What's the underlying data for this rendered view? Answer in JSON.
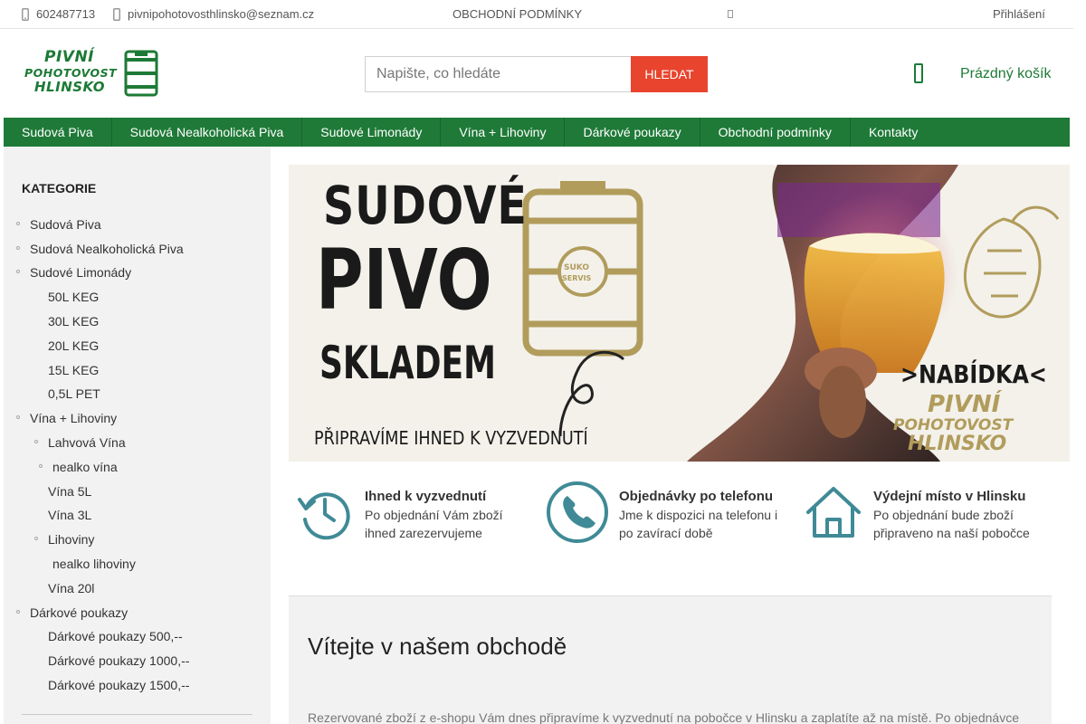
{
  "topbar": {
    "phone": "602487713",
    "email": "pivnipohotovosthlinsko@seznam.cz",
    "terms": "Obchodní podmínky",
    "login": "Přihlášení"
  },
  "logo": {
    "line1": "PIVNÍ",
    "line2": "POHOTOVOST",
    "line3": "HLINSKO"
  },
  "search": {
    "placeholder": "Napište, co hledáte",
    "button": "Hledat"
  },
  "cart": {
    "label": "Prázdný košík"
  },
  "nav": {
    "items": [
      {
        "label": "Sudová Piva"
      },
      {
        "label": "Sudová Nealkoholická Piva"
      },
      {
        "label": "Sudové Limonády"
      },
      {
        "label": "Vína + Lihoviny"
      },
      {
        "label": "Dárkové poukazy"
      },
      {
        "label": "Obchodní podmínky"
      },
      {
        "label": "Kontakty"
      }
    ]
  },
  "sidebar": {
    "title": "Kategorie",
    "categories": [
      {
        "label": "Sudová Piva"
      },
      {
        "label": "Sudová Nealkoholická Piva"
      },
      {
        "label": "Sudové Limonády"
      },
      {
        "label": "50L KEG"
      },
      {
        "label": "30L KEG"
      },
      {
        "label": "20L KEG"
      },
      {
        "label": "15L KEG"
      },
      {
        "label": "0,5L PET"
      },
      {
        "label": "Vína + Lihoviny"
      },
      {
        "label": "Lahvová Vína"
      },
      {
        "label": "nealko vína"
      },
      {
        "label": "Vína 5L"
      },
      {
        "label": "Vína 3L"
      },
      {
        "label": "Lihoviny"
      },
      {
        "label": "nealko lihoviny"
      },
      {
        "label": "Vína 20l"
      },
      {
        "label": "Dárkové poukazy"
      },
      {
        "label": "Dárkové poukazy 500,--"
      },
      {
        "label": "Dárkové poukazy 1000,--"
      },
      {
        "label": "Dárkové poukazy 1500,--"
      }
    ]
  },
  "banner": {
    "headline1": "SUDOVÉ",
    "headline2": "PIVO",
    "headline3": "SKLADEM",
    "subline": "PŘIPRAVÍME IHNED K VYZVEDNUTÍ",
    "keg_text1": "SUKO",
    "keg_text2": "SERVIS",
    "offer": ">NABÍDKA<",
    "brand1": "PIVNÍ",
    "brand2": "POHOTOVOST",
    "brand3": "HLINSKO"
  },
  "features": [
    {
      "title": "Ihned k vyzvednutí",
      "line1": "Po objednání Vám zboží",
      "line2": "ihned zarezervujeme",
      "icon": "clock-history-icon"
    },
    {
      "title": "Objednávky po telefonu",
      "line1": "Jme k dispozici na telefonu i",
      "line2": "po zavírací době",
      "icon": "phone-icon"
    },
    {
      "title": "Výdejní místo v Hlinsku",
      "line1": "Po objednání bude zboží",
      "line2": "připraveno na naší pobočce",
      "icon": "house-icon"
    }
  ],
  "welcome": {
    "title": "Vítejte v našem obchodě",
    "text": "Rezervované zboží z e-shopu Vám dnes připravíme k vyzvednutí na pobočce v Hlinsku a zaplatíte až na místě. Po objednávce"
  },
  "colors": {
    "brand_green": "#1f7a38",
    "accent_red": "#e8442e",
    "icon_teal": "#3f8a96",
    "banner_gold": "#b19c5c"
  }
}
